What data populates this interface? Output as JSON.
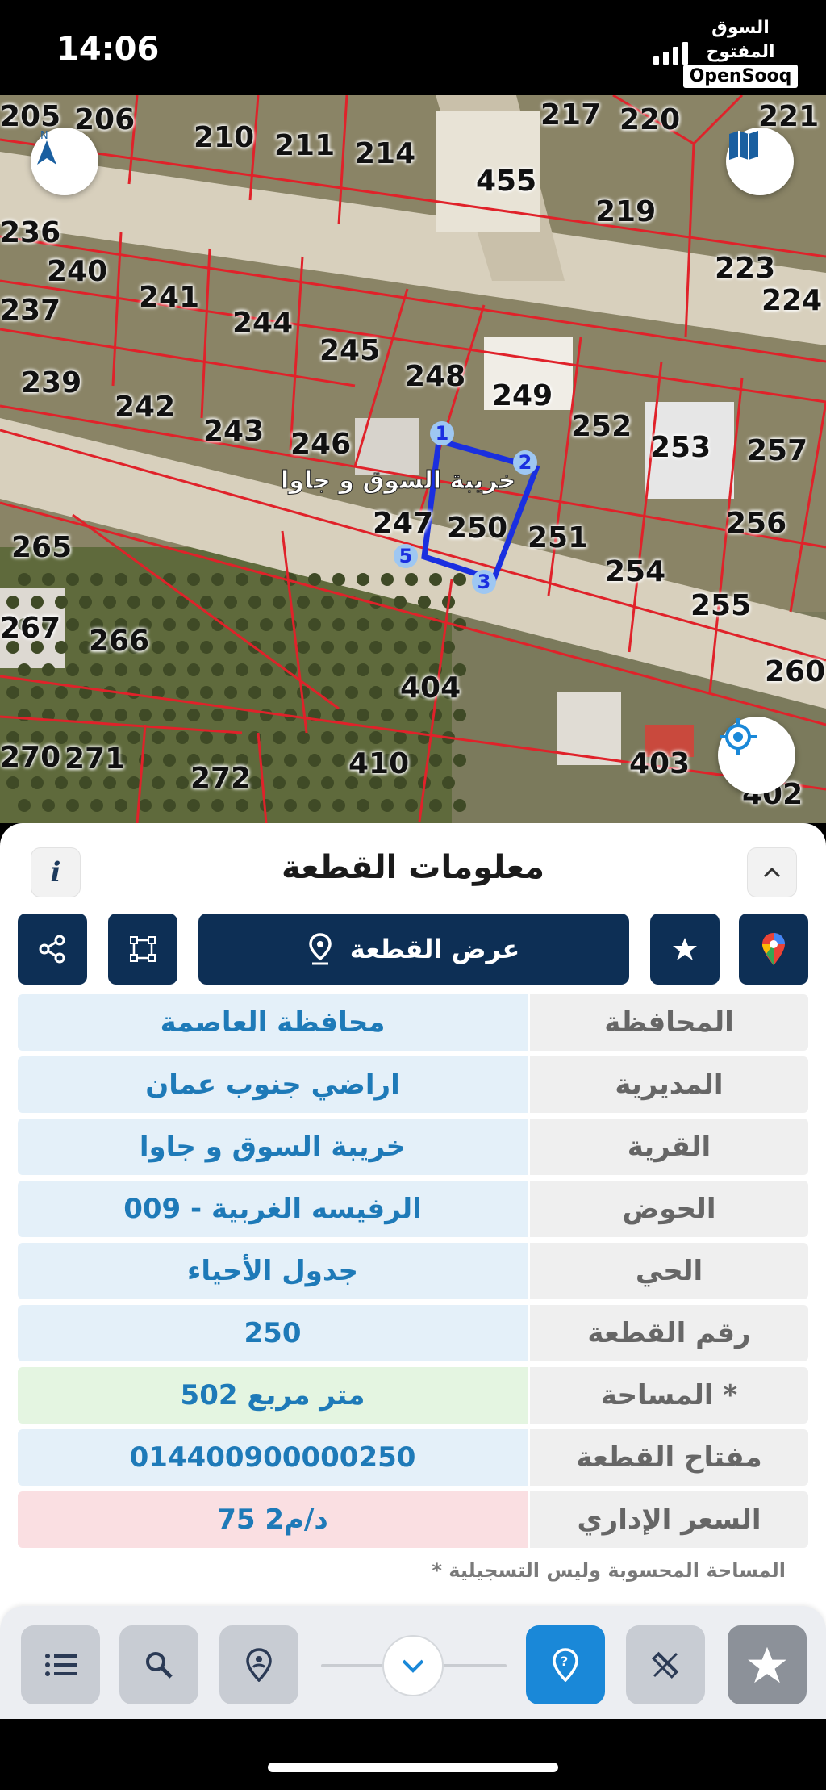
{
  "status": {
    "time": "14:06",
    "brand_ar": "السوق المفتوح",
    "brand_en": "OpenSooq"
  },
  "map": {
    "parcel_numbers": [
      "205",
      "206",
      "210",
      "211",
      "214",
      "217",
      "220",
      "221",
      "455",
      "219",
      "223",
      "224",
      "236",
      "240",
      "237",
      "241",
      "244",
      "245",
      "248",
      "239",
      "242",
      "243",
      "246",
      "249",
      "252",
      "253",
      "257",
      "256",
      "250",
      "251",
      "254",
      "255",
      "260",
      "265",
      "247",
      "267",
      "266",
      "404",
      "270",
      "271",
      "272",
      "410",
      "403",
      "402"
    ],
    "village_label": "خريبة السوق و جاوا",
    "vertex_labels": [
      "1",
      "2",
      "3",
      "5"
    ],
    "colors": {
      "parcel_line": "#e0222a",
      "selection": "#1a2fe0",
      "road": "#d9d2bf",
      "field": "#8a8466"
    }
  },
  "panel": {
    "title": "معلومات القطعة",
    "info_label": "i",
    "show_parcel_label": "عرض القطعة",
    "rows": [
      {
        "label": "المحافظة",
        "value": "محافظة العاصمة",
        "tone": "blue"
      },
      {
        "label": "المديرية",
        "value": "اراضي جنوب عمان",
        "tone": "blue"
      },
      {
        "label": "القرية",
        "value": "خريبة السوق  و جاوا",
        "tone": "blue"
      },
      {
        "label": "الحوض",
        "value": "الرفيسه الغربية - 009",
        "tone": "blue"
      },
      {
        "label": "الحي",
        "value": "جدول الأحياء",
        "tone": "blue"
      },
      {
        "label": "رقم القطعة",
        "value": "250",
        "tone": "blue"
      },
      {
        "label": "المساحة *",
        "value": "502  متر مربع",
        "tone": "green"
      },
      {
        "label": "مفتاح القطعة",
        "value": "014400900000250",
        "tone": "blue"
      },
      {
        "label": "السعر الإداري",
        "value": "75 د/م2",
        "tone": "pink"
      }
    ],
    "footnote": "* المساحة المحسوبة وليس التسجيلية"
  },
  "icons": {
    "compass": "compass-north-icon",
    "map_layers": "map-icon",
    "locate": "crosshair-icon",
    "info": "info-icon",
    "chevron_up": "chevron-up-icon",
    "share": "share-icon",
    "polygon": "polygon-icon",
    "pin": "location-pin-icon",
    "star": "star-icon",
    "google_maps": "google-maps-icon",
    "list": "list-icon",
    "search": "search-icon",
    "contact": "contact-pin-icon",
    "chevron_down": "chevron-down-icon",
    "help": "help-icon",
    "measure": "measure-icon"
  }
}
